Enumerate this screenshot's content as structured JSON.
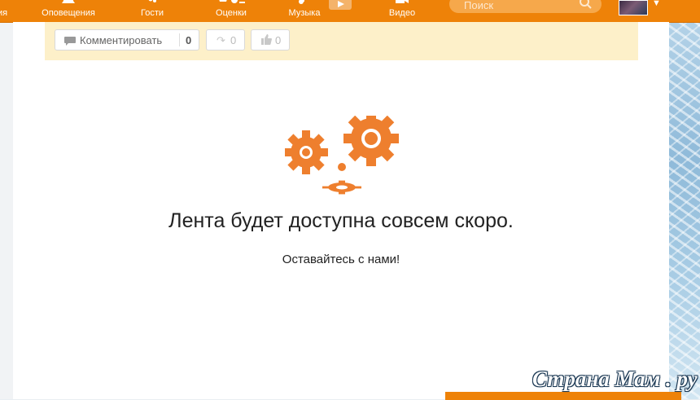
{
  "nav": {
    "items": [
      {
        "label": "ия",
        "icon": "partial-icon"
      },
      {
        "label": "Оповещения",
        "icon": "bell-icon"
      },
      {
        "label": "Гости",
        "icon": "footprints-icon"
      },
      {
        "label": "Оценки",
        "icon": "ratings-icon"
      },
      {
        "label": "Музыка",
        "icon": "music-note-icon"
      },
      {
        "label": "Видео",
        "icon": "video-camera-icon"
      }
    ],
    "search_placeholder": "Поиск",
    "accent_color": "#ee8208"
  },
  "post_actions": {
    "comment_label": "Комментировать",
    "comment_count": "0",
    "share_count": "0",
    "like_count": "0"
  },
  "feed": {
    "headline": "Лента будет доступна совсем скоро.",
    "subline": "Оставайтесь с нами!",
    "illustration": "gears-icon"
  },
  "watermark": "Страна Мам . ру"
}
